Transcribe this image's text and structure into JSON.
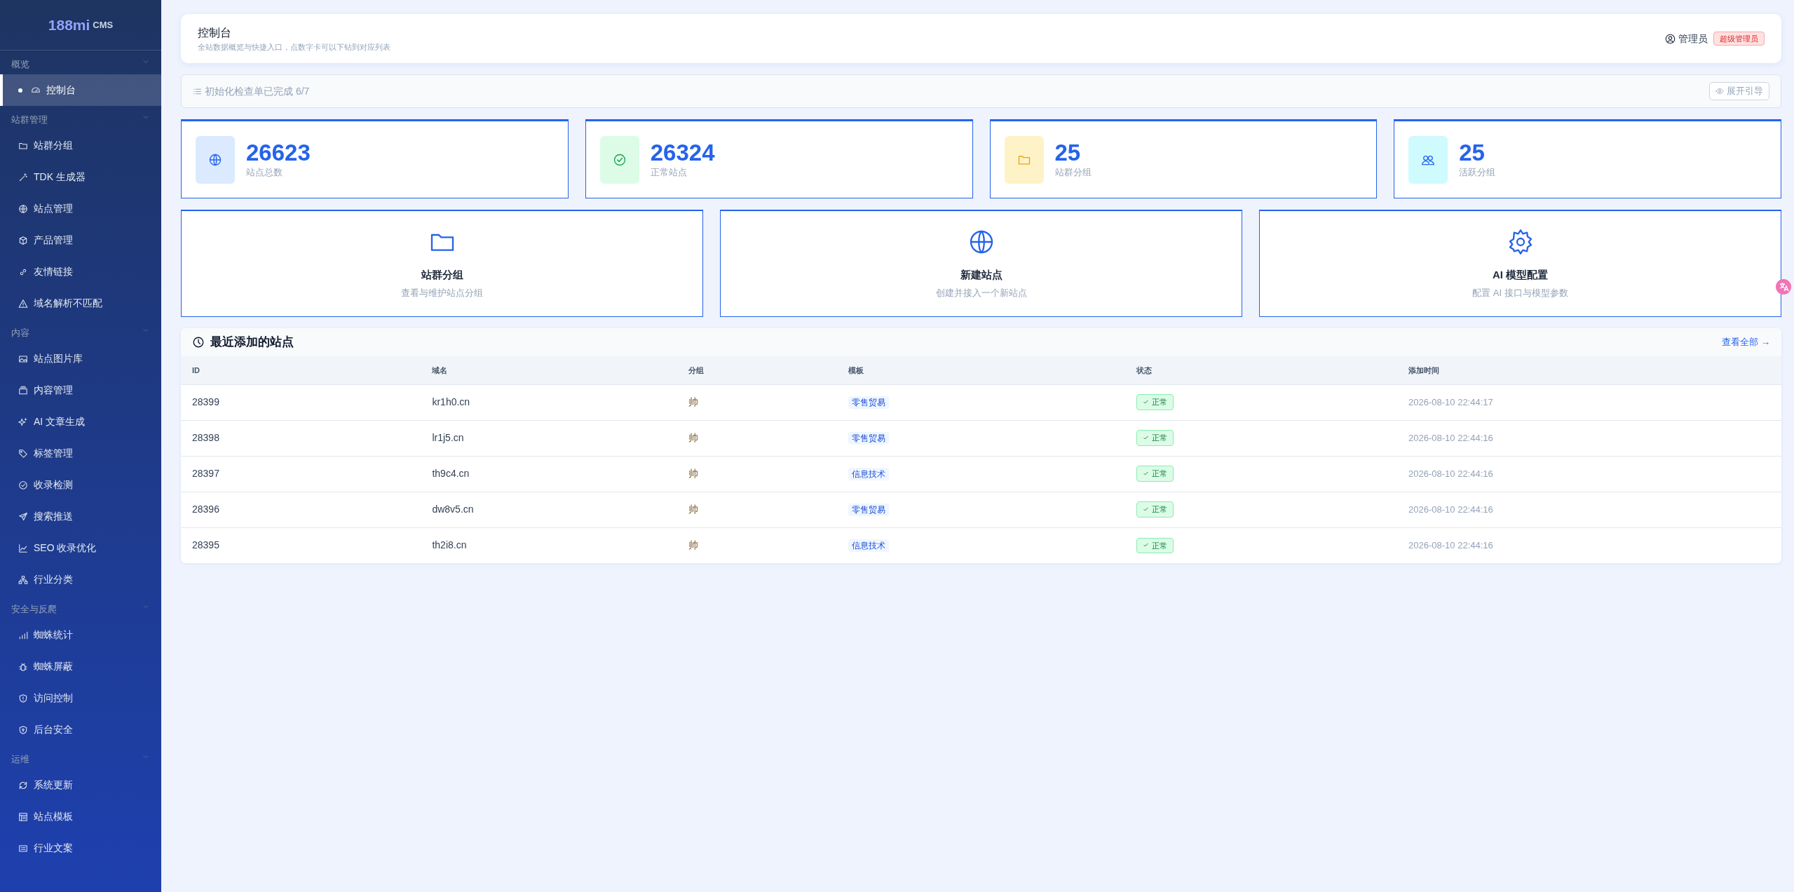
{
  "sidebar": {
    "logo": {
      "brand": "188mi",
      "suffix": "CMS"
    },
    "sections": [
      {
        "title": "概览",
        "items": [
          {
            "label": "控制台",
            "selected": true
          }
        ]
      },
      {
        "title": "站群管理",
        "items": [
          {
            "label": "站群分组",
            "selected": false
          },
          {
            "label": "TDK 生成器",
            "selected": false
          },
          {
            "label": "站点管理",
            "selected": false
          },
          {
            "label": "产品管理",
            "selected": false
          },
          {
            "label": "友情链接",
            "selected": false
          },
          {
            "label": "域名解析不匹配",
            "selected": false
          }
        ]
      },
      {
        "title": "内容",
        "items": [
          {
            "label": "站点图片库",
            "selected": false
          },
          {
            "label": "内容管理",
            "selected": false
          },
          {
            "label": "AI 文章生成",
            "selected": false
          },
          {
            "label": "标签管理",
            "selected": false
          },
          {
            "label": "收录检测",
            "selected": false
          },
          {
            "label": "搜索推送",
            "selected": false
          },
          {
            "label": "SEO 收录优化",
            "selected": false
          },
          {
            "label": "行业分类",
            "selected": false
          }
        ]
      },
      {
        "title": "安全与反爬",
        "items": [
          {
            "label": "蜘蛛统计",
            "selected": false
          },
          {
            "label": "蜘蛛屏蔽",
            "selected": false
          },
          {
            "label": "访问控制",
            "selected": false
          },
          {
            "label": "后台安全",
            "selected": false
          }
        ]
      },
      {
        "title": "运维",
        "items": [
          {
            "label": "系统更新",
            "selected": false
          },
          {
            "label": "站点模板",
            "selected": false
          },
          {
            "label": "行业文案",
            "selected": false
          }
        ]
      }
    ]
  },
  "header": {
    "title": "控制台",
    "subtitle": "全站数据概览与快捷入口，点数字卡可以下钻到对应列表",
    "user": "管理员",
    "role": "超级管理员"
  },
  "checklist": {
    "text": "初始化检查单已完成 6/7",
    "button": "展开引导"
  },
  "stats": [
    {
      "value": "26623",
      "label": "站点总数",
      "color": "#2563eb"
    },
    {
      "value": "26324",
      "label": "正常站点",
      "color": "#16a34a"
    },
    {
      "value": "25",
      "label": "站群分组",
      "color": "#f59e0b"
    },
    {
      "value": "25",
      "label": "活跃分组",
      "color": "#2563eb"
    }
  ],
  "shortcuts": [
    {
      "title": "站群分组",
      "desc": "查看与维护站点分组"
    },
    {
      "title": "新建站点",
      "desc": "创建并接入一个新站点"
    },
    {
      "title": "AI 模型配置",
      "desc": "配置 AI 接口与模型参数"
    }
  ],
  "recent": {
    "title": "最近添加的站点",
    "link": "查看全部 →",
    "columns": [
      "ID",
      "域名",
      "分组",
      "模板",
      "状态",
      "添加时间"
    ],
    "rows": [
      {
        "id": "28399",
        "domain": "kr1h0.cn",
        "group": "帅",
        "template": "零售贸易",
        "status": "正常",
        "time": "2026-08-10 22:44:17"
      },
      {
        "id": "28398",
        "domain": "lr1j5.cn",
        "group": "帅",
        "template": "零售贸易",
        "status": "正常",
        "time": "2026-08-10 22:44:16"
      },
      {
        "id": "28397",
        "domain": "th9c4.cn",
        "group": "帅",
        "template": "信息技术",
        "status": "正常",
        "time": "2026-08-10 22:44:16"
      },
      {
        "id": "28396",
        "domain": "dw8v5.cn",
        "group": "帅",
        "template": "零售贸易",
        "status": "正常",
        "time": "2026-08-10 22:44:16"
      },
      {
        "id": "28395",
        "domain": "th2i8.cn",
        "group": "帅",
        "template": "信息技术",
        "status": "正常",
        "time": "2026-08-10 22:44:16"
      }
    ]
  }
}
